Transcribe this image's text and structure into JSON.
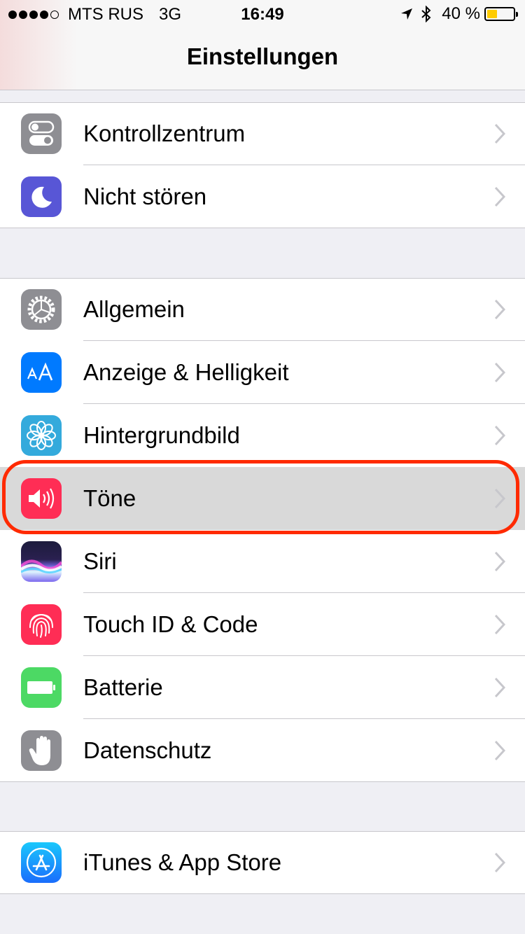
{
  "status_bar": {
    "carrier": "MTS RUS",
    "network": "3G",
    "time": "16:49",
    "battery_percent": "40 %",
    "battery_level": 0.4
  },
  "nav": {
    "title": "Einstellungen"
  },
  "groups": [
    {
      "items": [
        {
          "label": "Kontrollzentrum",
          "icon": "control-center-icon",
          "color": "#8e8e93"
        },
        {
          "label": "Nicht stören",
          "icon": "moon-icon",
          "color": "#5856d6"
        }
      ]
    },
    {
      "items": [
        {
          "label": "Allgemein",
          "icon": "gear-icon",
          "color": "#8e8e93"
        },
        {
          "label": "Anzeige & Helligkeit",
          "icon": "text-size-icon",
          "color": "#007aff"
        },
        {
          "label": "Hintergrundbild",
          "icon": "flower-icon",
          "color": "#34aadc"
        },
        {
          "label": "Töne",
          "icon": "speaker-icon",
          "color": "#ff2d55",
          "selected": true
        },
        {
          "label": "Siri",
          "icon": "siri-icon",
          "color": "#1c1c3c"
        },
        {
          "label": "Touch ID & Code",
          "icon": "fingerprint-icon",
          "color": "#ff2d55"
        },
        {
          "label": "Batterie",
          "icon": "battery-icon",
          "color": "#4cd964"
        },
        {
          "label": "Datenschutz",
          "icon": "hand-icon",
          "color": "#8e8e93"
        }
      ]
    },
    {
      "items": [
        {
          "label": "iTunes & App Store",
          "icon": "app-store-icon",
          "color": "#1a8cff"
        }
      ]
    }
  ],
  "highlight_color": "#ff2a00"
}
